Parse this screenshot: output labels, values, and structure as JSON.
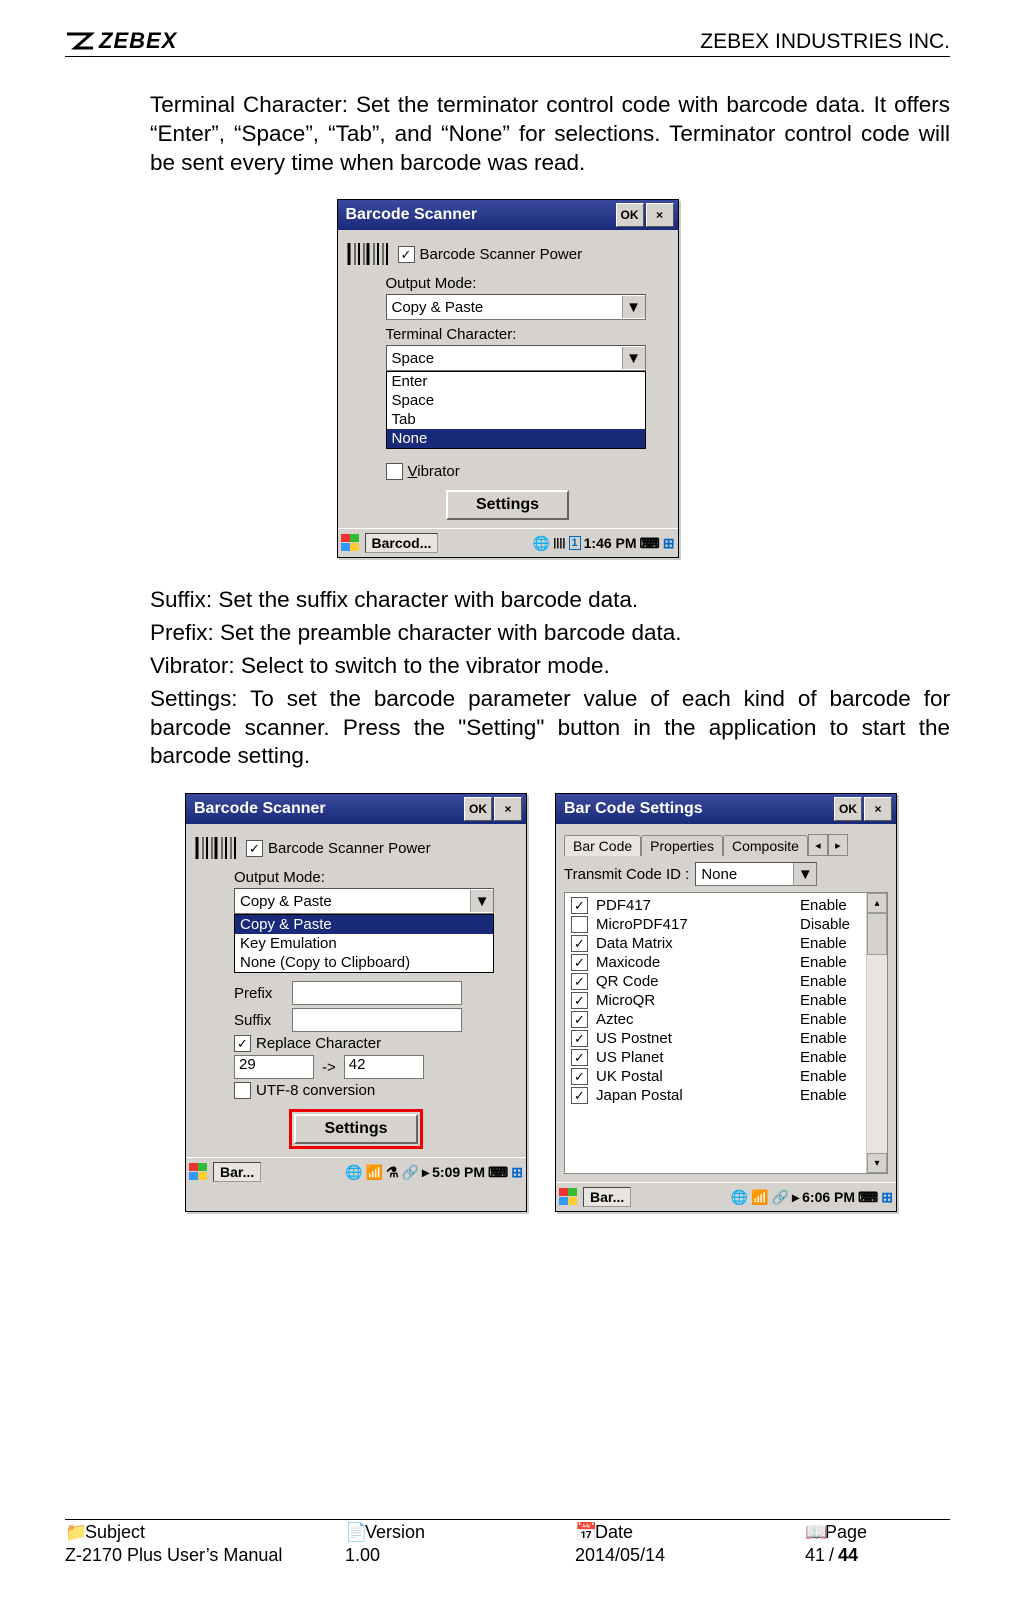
{
  "header": {
    "logo_text": "ZEBEX",
    "company": "ZEBEX INDUSTRIES INC."
  },
  "text": {
    "para1": "Terminal Character: Set the terminator control code with barcode data. It offers “Enter”, “Space”, “Tab”, and “None” for selections. Terminator control code will be sent every time when barcode was read.",
    "suffix": "Suffix: Set the suffix character with barcode data.",
    "prefix": "Prefix: Set the preamble character with barcode data.",
    "vibrator": "Vibrator: Select to switch to the vibrator mode.",
    "settings": "Settings: To set the barcode parameter value of each kind of barcode for barcode scanner. Press the \"Setting\" button in the application to start the barcode setting."
  },
  "win1": {
    "title": "Barcode Scanner",
    "ok": "OK",
    "close": "×",
    "power_label": "Barcode Scanner Power",
    "output_mode_label": "Output Mode:",
    "output_mode_value": "Copy & Paste",
    "terminal_label": "Terminal Character:",
    "terminal_value": "Space",
    "terminal_options": [
      "Enter",
      "Space",
      "Tab",
      "None"
    ],
    "terminal_selected": "None",
    "vibrator_label": "Vibrator",
    "settings_btn": "Settings",
    "taskbar_app": "Barcod...",
    "taskbar_time": "1:46 PM"
  },
  "win2": {
    "title": "Barcode Scanner",
    "ok": "OK",
    "close": "×",
    "power_label": "Barcode Scanner Power",
    "output_mode_label": "Output Mode:",
    "output_mode_value": "Copy & Paste",
    "output_options": [
      "Copy & Paste",
      "Key Emulation",
      "None (Copy to Clipboard)"
    ],
    "output_selected": "Copy & Paste",
    "prefix_label": "Prefix",
    "suffix_label": "Suffix",
    "replace_label": "Replace Character",
    "replace_from": "29",
    "replace_arrow": "->",
    "replace_to": "42",
    "utf8_label": "UTF-8 conversion",
    "settings_btn": "Settings",
    "taskbar_app": "Bar...",
    "taskbar_time": "5:09 PM"
  },
  "win3": {
    "title": "Bar Code Settings",
    "ok": "OK",
    "close": "×",
    "tabs": [
      "Bar Code",
      "Properties",
      "Composite"
    ],
    "transmit_label": "Transmit Code ID :",
    "transmit_value": "None",
    "codes": [
      {
        "name": "PDF417",
        "checked": true,
        "status": "Enable"
      },
      {
        "name": "MicroPDF417",
        "checked": false,
        "status": "Disable"
      },
      {
        "name": "Data Matrix",
        "checked": true,
        "status": "Enable"
      },
      {
        "name": "Maxicode",
        "checked": true,
        "status": "Enable"
      },
      {
        "name": "QR Code",
        "checked": true,
        "status": "Enable"
      },
      {
        "name": "MicroQR",
        "checked": true,
        "status": "Enable"
      },
      {
        "name": "Aztec",
        "checked": true,
        "status": "Enable"
      },
      {
        "name": "US Postnet",
        "checked": true,
        "status": "Enable"
      },
      {
        "name": "US Planet",
        "checked": true,
        "status": "Enable"
      },
      {
        "name": "UK Postal",
        "checked": true,
        "status": "Enable"
      },
      {
        "name": "Japan Postal",
        "checked": true,
        "status": "Enable"
      }
    ],
    "taskbar_app": "Bar...",
    "taskbar_time": "6:06 PM"
  },
  "footer": {
    "subject_label": "Subject",
    "subject_value": "Z-2170 Plus User’s Manual",
    "version_label": "Version",
    "version_value": "1.00",
    "date_label": "Date",
    "date_value": "2014/05/14",
    "page_label": "Page",
    "page_current": "41",
    "page_sep": " / ",
    "page_total": "44"
  }
}
